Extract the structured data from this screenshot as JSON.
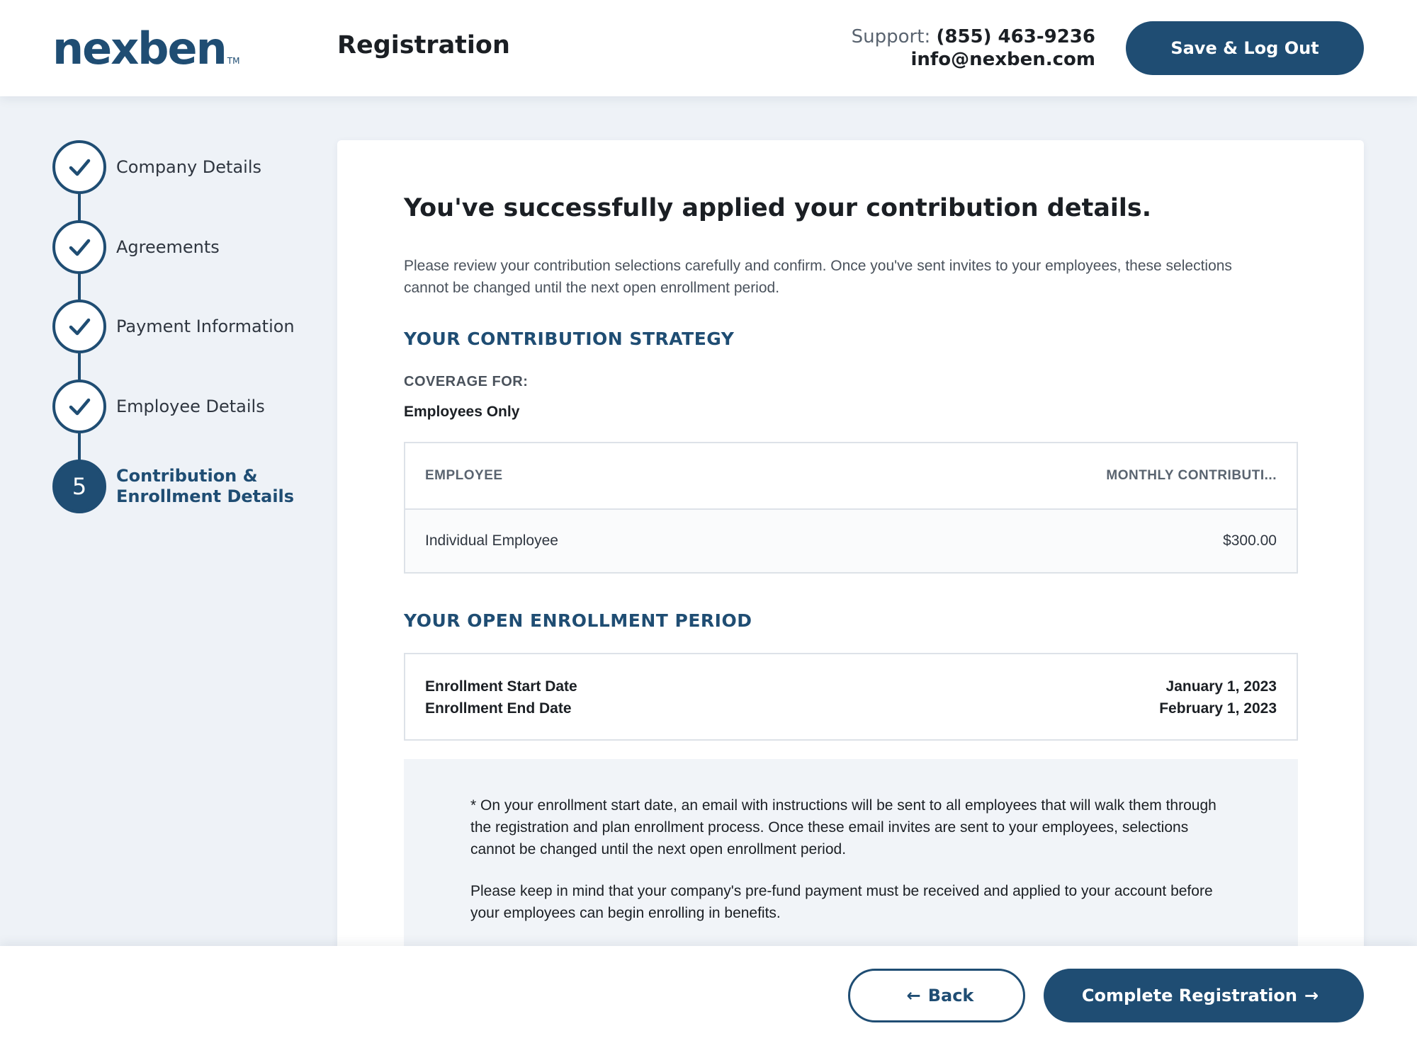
{
  "header": {
    "logo_text": "nexben",
    "logo_tm": "TM",
    "title": "Registration",
    "support_label": "Support:",
    "support_phone": "(855) 463-9236",
    "support_email": "info@nexben.com",
    "save_button": "Save & Log Out"
  },
  "steps": [
    {
      "label": "Company Details",
      "status": "complete",
      "icon": "check-icon"
    },
    {
      "label": "Agreements",
      "status": "complete",
      "icon": "check-icon"
    },
    {
      "label": "Payment Information",
      "status": "complete",
      "icon": "check-icon"
    },
    {
      "label": "Employee Details",
      "status": "complete",
      "icon": "check-icon"
    },
    {
      "number": "5",
      "label_line1": "Contribution &",
      "label_line2": "Enrollment Details",
      "status": "active"
    }
  ],
  "main": {
    "title": "You've successfully applied your contribution details.",
    "intro": "Please review your contribution selections carefully and confirm. Once you've sent invites to your employees, these selections cannot be changed until the next open enrollment period.",
    "strategy_heading": "YOUR CONTRIBUTION STRATEGY",
    "coverage_label": "COVERAGE FOR:",
    "coverage_value": "Employees Only",
    "table": {
      "headers": [
        "EMPLOYEE",
        "MONTHLY CONTRIBUTI..."
      ],
      "rows": [
        {
          "employee": "Individual Employee",
          "contribution": "$300.00"
        }
      ]
    },
    "enrollment_heading": "YOUR OPEN ENROLLMENT PERIOD",
    "enrollment": {
      "start_label": "Enrollment Start Date",
      "end_label": "Enrollment End Date",
      "start_value": "January 1, 2023",
      "end_value": "February 1, 2023"
    },
    "notice": {
      "paragraph1": "* On your enrollment start date, an email with instructions will be sent to all employees that will walk them through the registration and plan enrollment process. Once these email invites are sent to your employees, selections cannot be changed until the next open enrollment period.",
      "paragraph2": "Please keep in mind that your company's pre-fund payment must be received and applied to your account before your employees can begin enrolling in benefits."
    }
  },
  "footer": {
    "back_label": "Back",
    "complete_label": "Complete Registration"
  },
  "colors": {
    "brand": "#1f4d73",
    "background": "#eef2f7",
    "card": "#ffffff",
    "notice_bg": "#f1f4f8"
  }
}
